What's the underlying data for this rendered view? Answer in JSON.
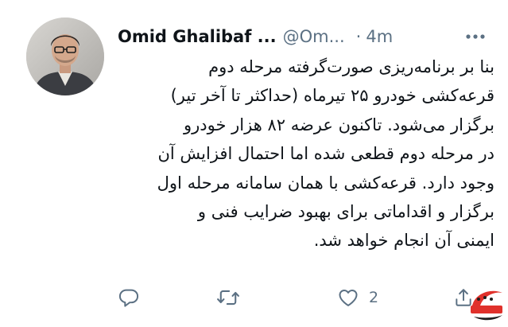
{
  "tweet": {
    "author_name": "Omid Ghalibaf ...",
    "handle": "@Om...",
    "separator": "·",
    "time": "4m",
    "more_icon": "more-horizontal-icon",
    "text_lines": [
      "بنا بر برنامه‌ریزی صورت‌گرفته مرحله دوم",
      "قرعه‌کشی خودرو ۲۵ تیرماه (حداکثر تا آخر تیر)",
      "برگزار می‌شود. تاکنون عرضه ۸۲ هزار خودرو",
      "در مرحله دوم قطعی شده اما احتمال افزایش آن",
      "وجود دارد. قرعه‌کشی با همان سامانه مرحله اول",
      "برگزار و اقداماتی برای بهبود ضرایب فنی و",
      "ایمنی آن انجام خواهد شد."
    ],
    "actions": {
      "reply_icon": "reply-icon",
      "retweet_icon": "retweet-icon",
      "like_icon": "heart-icon",
      "like_count": "2",
      "share_icon": "share-icon"
    }
  },
  "colors": {
    "text": "#0f1419",
    "secondary": "#5b7083",
    "watermark_red": "#e0312b"
  }
}
